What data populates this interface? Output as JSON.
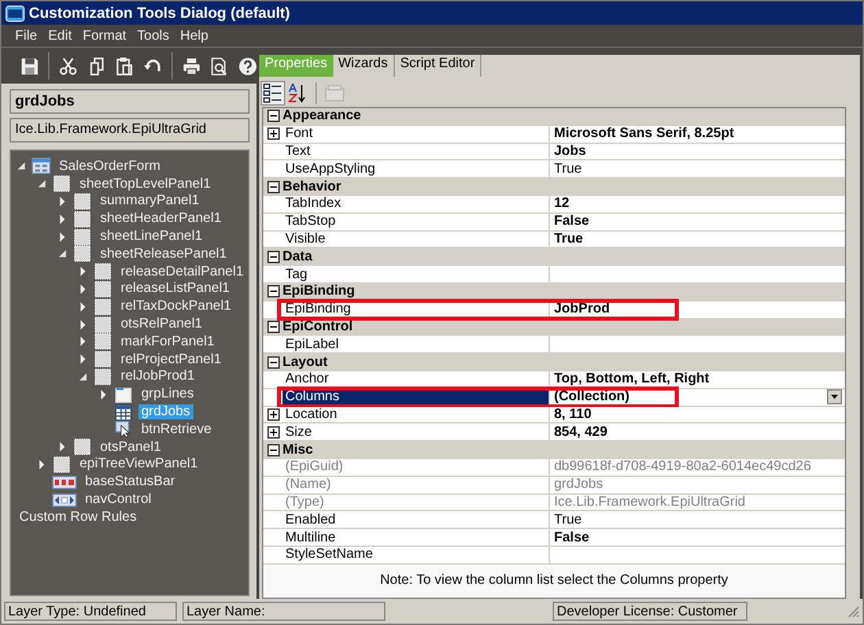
{
  "window": {
    "title": "Customization Tools Dialog (default)"
  },
  "menu": [
    "File",
    "Edit",
    "Format",
    "Tools",
    "Help"
  ],
  "toolbar": [
    {
      "kind": "save"
    },
    {
      "kind": "cut"
    },
    {
      "kind": "copy"
    },
    {
      "kind": "paste"
    },
    {
      "kind": "undo"
    },
    {
      "kind": "print"
    },
    {
      "kind": "find"
    },
    {
      "kind": "help"
    }
  ],
  "selected_control": {
    "name": "grdJobs",
    "type": "Ice.Lib.Framework.EpiUltraGrid"
  },
  "tree": [
    {
      "label": "SalesOrderForm",
      "kind": "form",
      "expanded": true,
      "selected": false,
      "children": [
        {
          "label": "sheetTopLevelPanel1",
          "kind": "panel",
          "expanded": true,
          "selected": false,
          "children": [
            {
              "label": "summaryPanel1",
              "kind": "panel",
              "expanded": false,
              "selected": false
            },
            {
              "label": "sheetHeaderPanel1",
              "kind": "panel",
              "expanded": false,
              "selected": false
            },
            {
              "label": "sheetLinePanel1",
              "kind": "panel",
              "expanded": false,
              "selected": false
            },
            {
              "label": "sheetReleasePanel1",
              "kind": "panel",
              "expanded": true,
              "selected": false,
              "children": [
                {
                  "label": "releaseDetailPanel1",
                  "kind": "panel",
                  "expanded": false,
                  "selected": false
                },
                {
                  "label": "releaseListPanel1",
                  "kind": "panel",
                  "expanded": false,
                  "selected": false
                },
                {
                  "label": "relTaxDockPanel1",
                  "kind": "panel",
                  "expanded": false,
                  "selected": false
                },
                {
                  "label": "otsRelPanel1",
                  "kind": "panel",
                  "expanded": false,
                  "selected": false
                },
                {
                  "label": "markForPanel1",
                  "kind": "panel",
                  "expanded": false,
                  "selected": false
                },
                {
                  "label": "relProjectPanel1",
                  "kind": "panel",
                  "expanded": false,
                  "selected": false
                },
                {
                  "label": "relJobProd1",
                  "kind": "panel",
                  "expanded": true,
                  "selected": false,
                  "children": [
                    {
                      "label": "grpLines",
                      "kind": "group",
                      "expanded": false,
                      "selected": false
                    },
                    {
                      "label": "grdJobs",
                      "kind": "grid",
                      "selected": true
                    },
                    {
                      "label": "btnRetrieve",
                      "kind": "button",
                      "selected": false
                    }
                  ]
                }
              ]
            },
            {
              "label": "otsPanel1",
              "kind": "panel",
              "expanded": false,
              "selected": false
            }
          ]
        },
        {
          "label": "epiTreeViewPanel1",
          "kind": "panel",
          "expanded": false,
          "selected": false
        },
        {
          "label": "baseStatusBar",
          "kind": "statusbar",
          "selected": false
        },
        {
          "label": "navControl",
          "kind": "navcontrol",
          "selected": false
        }
      ]
    },
    {
      "label": "Custom Row Rules",
      "kind": "plain",
      "selected": false
    }
  ],
  "tabs": [
    {
      "label": "Properties",
      "selected": true
    },
    {
      "label": "Wizards",
      "selected": false
    },
    {
      "label": "Script Editor",
      "selected": false
    }
  ],
  "property_toolbar": [
    {
      "kind": "categorized",
      "selected": true,
      "disabled": false
    },
    {
      "kind": "alphabetical",
      "selected": false,
      "disabled": false
    },
    {
      "kind": "pages",
      "selected": false,
      "disabled": true
    }
  ],
  "categories": [
    {
      "name": "Appearance",
      "expanded": true,
      "rows": [
        {
          "name": "Font",
          "value": "Microsoft Sans Serif, 8.25pt",
          "bold": true,
          "expandable": true,
          "readonly": false,
          "selected": false,
          "highlighted": false
        },
        {
          "name": "Text",
          "value": "Jobs",
          "bold": true,
          "expandable": false,
          "readonly": false,
          "selected": false,
          "highlighted": false
        },
        {
          "name": "UseAppStyling",
          "value": "True",
          "bold": false,
          "expandable": false,
          "readonly": false,
          "selected": false,
          "highlighted": false
        }
      ]
    },
    {
      "name": "Behavior",
      "expanded": true,
      "rows": [
        {
          "name": "TabIndex",
          "value": "12",
          "bold": true,
          "expandable": false,
          "readonly": false,
          "selected": false,
          "highlighted": false
        },
        {
          "name": "TabStop",
          "value": "False",
          "bold": true,
          "expandable": false,
          "readonly": false,
          "selected": false,
          "highlighted": false
        },
        {
          "name": "Visible",
          "value": "True",
          "bold": true,
          "expandable": false,
          "readonly": false,
          "selected": false,
          "highlighted": false
        }
      ]
    },
    {
      "name": "Data",
      "expanded": true,
      "rows": [
        {
          "name": "Tag",
          "expandable": false,
          "readonly": false,
          "selected": false,
          "highlighted": false
        }
      ]
    },
    {
      "name": "EpiBinding",
      "expanded": true,
      "rows": [
        {
          "name": "EpiBinding",
          "value": "JobProd",
          "bold": true,
          "expandable": false,
          "readonly": false,
          "selected": false,
          "highlighted": true
        }
      ]
    },
    {
      "name": "EpiControl",
      "expanded": true,
      "rows": [
        {
          "name": "EpiLabel",
          "expandable": false,
          "readonly": false,
          "selected": false,
          "highlighted": false
        }
      ]
    },
    {
      "name": "Layout",
      "expanded": true,
      "rows": [
        {
          "name": "Anchor",
          "value": "Top, Bottom, Left, Right",
          "bold": true,
          "expandable": false,
          "readonly": false,
          "selected": false,
          "highlighted": false
        },
        {
          "name": "Columns",
          "value": "(Collection)",
          "bold": true,
          "expandable": false,
          "readonly": false,
          "selected": true,
          "highlighted": true
        },
        {
          "name": "Location",
          "value": "8, 110",
          "bold": true,
          "expandable": true,
          "readonly": false,
          "selected": false,
          "highlighted": false
        },
        {
          "name": "Size",
          "value": "854, 429",
          "bold": true,
          "expandable": true,
          "readonly": false,
          "selected": false,
          "highlighted": false
        }
      ]
    },
    {
      "name": "Misc",
      "expanded": true,
      "rows": [
        {
          "name": "(EpiGuid)",
          "value": "db99618f-d708-4919-80a2-6014ec49cd26",
          "bold": false,
          "expandable": false,
          "readonly": true,
          "selected": false,
          "highlighted": false
        },
        {
          "name": "(Name)",
          "value": "grdJobs",
          "bold": false,
          "expandable": false,
          "readonly": true,
          "selected": false,
          "highlighted": false
        },
        {
          "name": "(Type)",
          "value": "Ice.Lib.Framework.EpiUltraGrid",
          "bold": false,
          "expandable": false,
          "readonly": true,
          "selected": false,
          "highlighted": false
        },
        {
          "name": "Enabled",
          "value": "True",
          "bold": false,
          "expandable": false,
          "readonly": false,
          "selected": false,
          "highlighted": false
        },
        {
          "name": "Multiline",
          "value": "False",
          "bold": true,
          "expandable": false,
          "readonly": false,
          "selected": false,
          "highlighted": false
        },
        {
          "name": "StyleSetName",
          "expandable": false,
          "readonly": false,
          "selected": false,
          "highlighted": false
        }
      ]
    }
  ],
  "note": "Note:  To view the column list select the Columns property",
  "status_bar": [
    "Layer Type:  Undefined",
    "Layer Name:",
    "Developer License:  Customer"
  ]
}
